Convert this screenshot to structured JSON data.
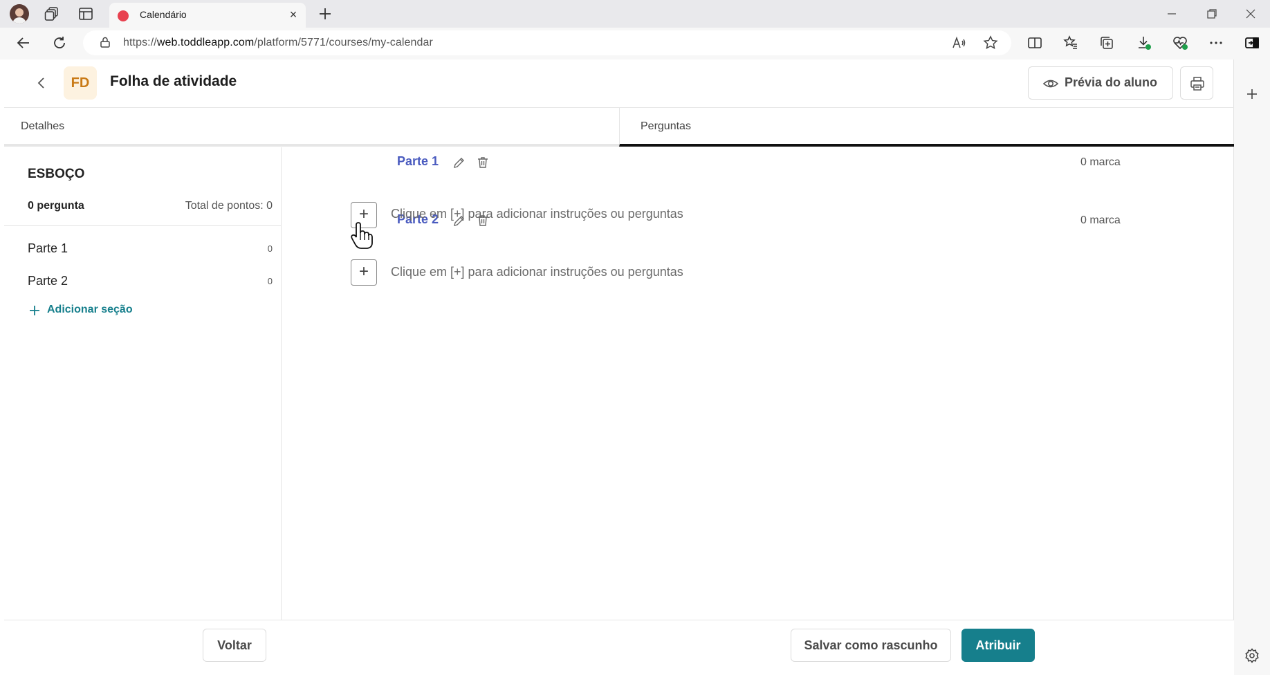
{
  "browser": {
    "tab_title": "Calendário",
    "url_prefix": "https://",
    "url_domain": "web.toddleapp.com",
    "url_path": "/platform/5771/courses/my-calendar"
  },
  "header": {
    "avatar_initials": "FD",
    "title": "Folha de atividade",
    "preview_label": "Prévia do aluno"
  },
  "tabs": [
    {
      "label": "Detalhes"
    },
    {
      "label": "Perguntas"
    }
  ],
  "sidebar": {
    "heading": "ESBOÇO",
    "question_count": "0 pergunta",
    "total_points": "Total de pontos: 0",
    "sections": [
      {
        "label": "Parte 1",
        "points": "0"
      },
      {
        "label": "Parte 2",
        "points": "0"
      }
    ],
    "add_section_label": "Adicionar seção"
  },
  "main": {
    "parts": [
      {
        "name": "Parte 1",
        "marks": "0 marca",
        "hint": "Clique em [+] para adicionar instruções ou perguntas"
      },
      {
        "name": "Parte 2",
        "marks": "0 marca",
        "hint": "Clique em [+] para adicionar instruções ou perguntas"
      }
    ]
  },
  "footer": {
    "back_label": "Voltar",
    "save_draft_label": "Salvar como rascunho",
    "assign_label": "Atribuir"
  },
  "colors": {
    "accent": "#167f8c",
    "part_title": "#4a5bbf",
    "avatar_bg": "#fdf2e0",
    "avatar_text": "#c97a16"
  }
}
